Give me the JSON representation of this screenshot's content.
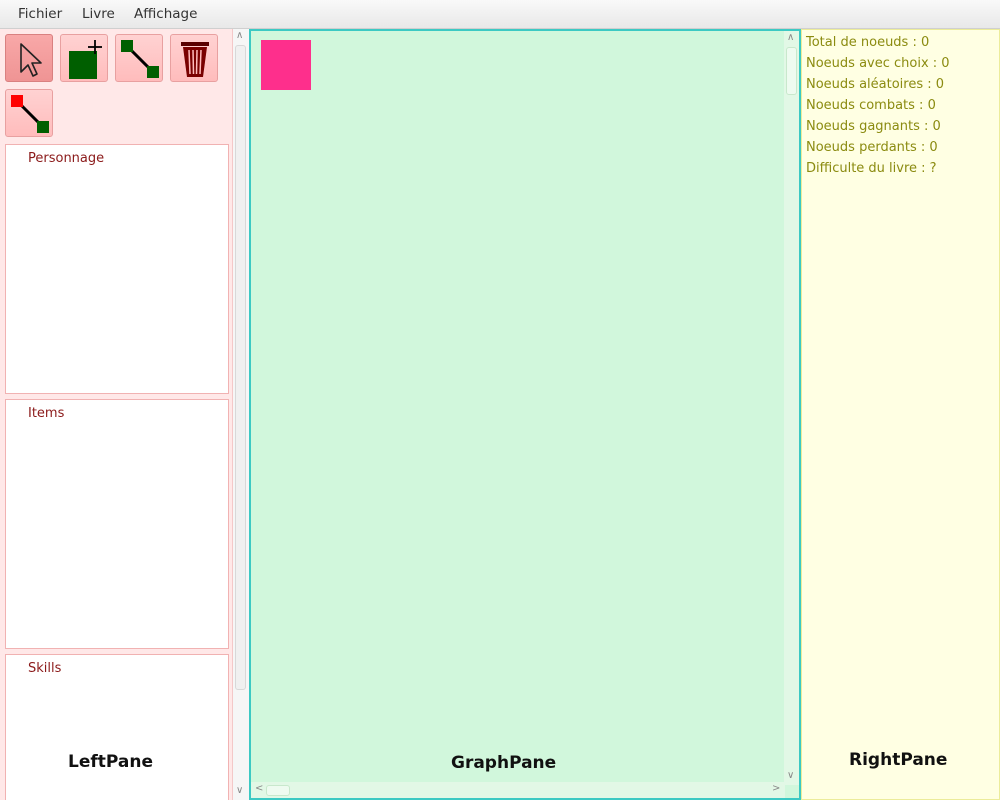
{
  "menubar": {
    "items": [
      {
        "label": "Fichier"
      },
      {
        "label": "Livre"
      },
      {
        "label": "Affichage"
      }
    ]
  },
  "left_pane": {
    "tools": [
      {
        "icon": "select-arrow-icon",
        "selected": true
      },
      {
        "icon": "add-node-icon",
        "selected": false
      },
      {
        "icon": "link-nodes-icon",
        "selected": false
      },
      {
        "icon": "trash-icon",
        "selected": false
      },
      {
        "icon": "set-start-node-icon",
        "selected": false
      }
    ],
    "sections": [
      {
        "title": "Personnage"
      },
      {
        "title": "Items"
      },
      {
        "title": "Skills"
      }
    ],
    "caption": "LeftPane"
  },
  "graph_pane": {
    "caption": "GraphPane",
    "node_color": "#fe2f8c"
  },
  "right_pane": {
    "stats": [
      "Total de noeuds : 0",
      "Noeuds avec choix : 0",
      "Noeuds aléatoires : 0",
      "Noeuds combats : 0",
      "Noeuds gagnants : 0",
      "Noeuds perdants : 0",
      "Difficulte du livre : ?"
    ],
    "caption": "RightPane"
  },
  "colors": {
    "left_bg": "#ffe8e8",
    "graph_bg": "#d1f7dc",
    "graph_border": "#3cc9c3",
    "right_bg": "#ffffe3",
    "stat_text": "#8b8b10",
    "section_title": "#8b1a1a",
    "node_fill": "#fe2f8c",
    "icon_green": "#005f00",
    "icon_red": "#ff0000"
  }
}
